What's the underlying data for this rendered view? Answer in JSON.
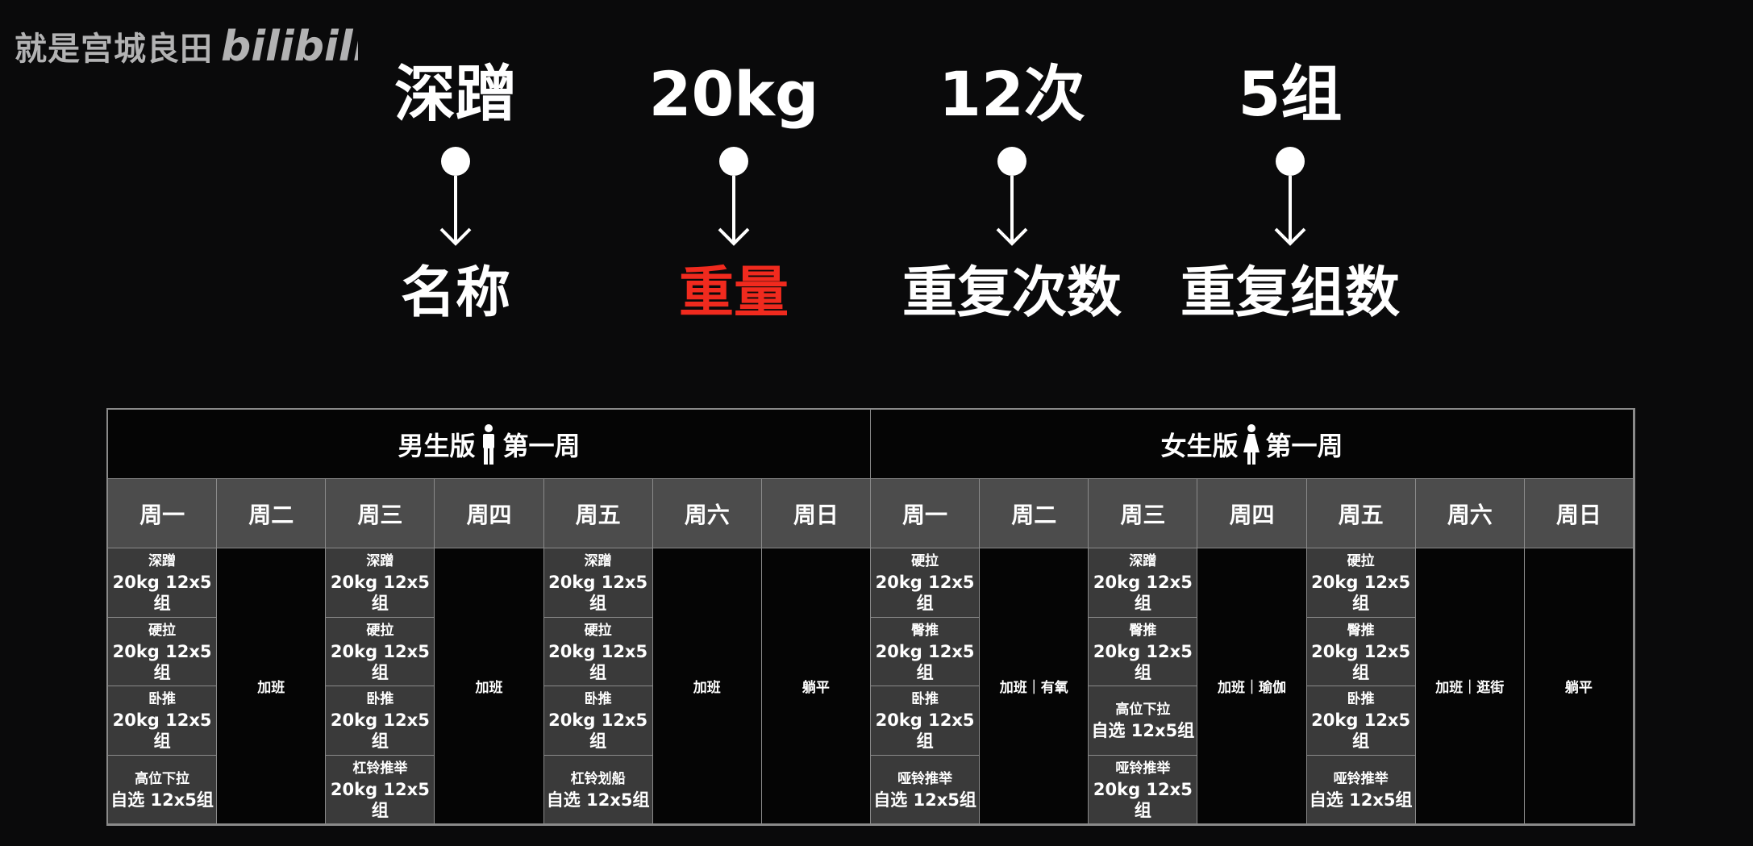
{
  "watermark": {
    "text": "就是宫城良田",
    "logo": "bilibili"
  },
  "terms": [
    {
      "top": "深蹭",
      "bottom": "名称",
      "highlight": false
    },
    {
      "top": "20kg",
      "bottom": "重量",
      "highlight": true
    },
    {
      "top": "12次",
      "bottom": "重复次数",
      "highlight": false
    },
    {
      "top": "5组",
      "bottom": "重复组数",
      "highlight": false
    }
  ],
  "colors": {
    "highlight": "#f02a1e",
    "header_cell": "#4c4c4c",
    "exercise_cell": "#3a3a3a"
  },
  "plan": {
    "men": {
      "title_left": "男生版",
      "title_right": "第一周",
      "icon": "male-person-icon",
      "days": [
        "周一",
        "周二",
        "周三",
        "周四",
        "周五",
        "周六",
        "周日"
      ],
      "columns": [
        [
          [
            "深蹭",
            "20kg 12x5组"
          ],
          [
            "硬拉",
            "20kg 12x5组"
          ],
          [
            "卧推",
            "20kg 12x5组"
          ],
          [
            "高位下拉",
            "自选 12x5组"
          ]
        ],
        "加班",
        [
          [
            "深蹭",
            "20kg 12x5组"
          ],
          [
            "硬拉",
            "20kg 12x5组"
          ],
          [
            "卧推",
            "20kg 12x5组"
          ],
          [
            "杠铃推举",
            "20kg 12x5组"
          ]
        ],
        "加班",
        [
          [
            "深蹭",
            "20kg 12x5组"
          ],
          [
            "硬拉",
            "20kg 12x5组"
          ],
          [
            "卧推",
            "20kg 12x5组"
          ],
          [
            "杠铃划船",
            "自选 12x5组"
          ]
        ],
        "加班",
        "躺平"
      ]
    },
    "women": {
      "title_left": "女生版",
      "title_right": "第一周",
      "icon": "female-person-icon",
      "days": [
        "周一",
        "周二",
        "周三",
        "周四",
        "周五",
        "周六",
        "周日"
      ],
      "columns": [
        [
          [
            "硬拉",
            "20kg 12x5组"
          ],
          [
            "臀推",
            "20kg 12x5组"
          ],
          [
            "卧推",
            "20kg 12x5组"
          ],
          [
            "哑铃推举",
            "自选 12x5组"
          ]
        ],
        "加班｜有氧",
        [
          [
            "深蹭",
            "20kg 12x5组"
          ],
          [
            "臀推",
            "20kg 12x5组"
          ],
          [
            "高位下拉",
            "自选 12x5组"
          ],
          [
            "哑铃推举",
            "20kg 12x5组"
          ]
        ],
        "加班｜瑜伽",
        [
          [
            "硬拉",
            "20kg 12x5组"
          ],
          [
            "臀推",
            "20kg 12x5组"
          ],
          [
            "卧推",
            "20kg 12x5组"
          ],
          [
            "哑铃推举",
            "自选 12x5组"
          ]
        ],
        "加班｜逛街",
        "躺平"
      ]
    }
  }
}
